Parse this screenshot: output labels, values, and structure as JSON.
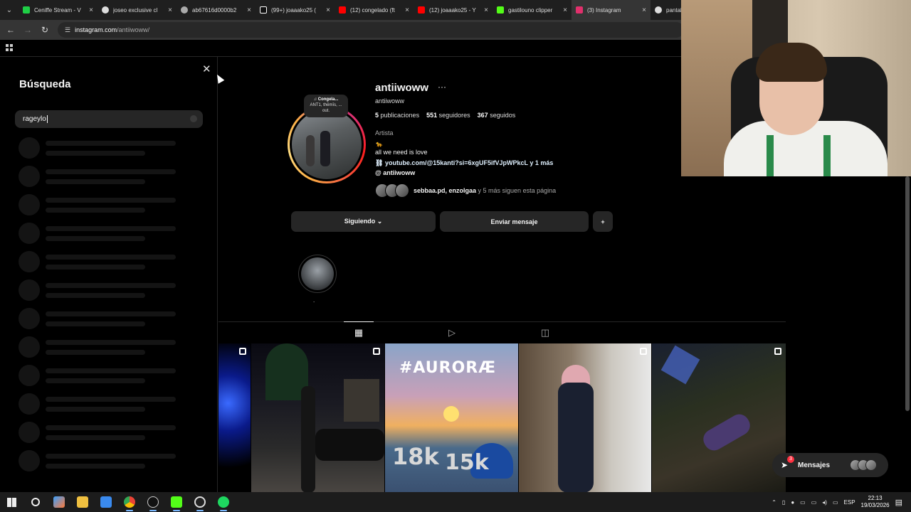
{
  "browser": {
    "tabs": [
      {
        "title": "Ceniffe Stream - V",
        "fav": "#1fcf46"
      },
      {
        "title": "joseo exclusive cl",
        "fav": "#dddddd"
      },
      {
        "title": "ab67616d0000b2",
        "fav": "#aaaaaa"
      },
      {
        "title": "(99+) joaaako25 (",
        "fav": "#111111"
      },
      {
        "title": "(12) congelado (ft",
        "fav": "#ff0000"
      },
      {
        "title": "(12) joaaako25 - Y",
        "fav": "#ff0000"
      },
      {
        "title": "gastilouno clipper",
        "fav": "#53fc18"
      },
      {
        "title": "(3) Instagram",
        "fav": "#e1306c"
      },
      {
        "title": "pantal",
        "fav": "#dddddd"
      }
    ],
    "url_host": "instagram.com",
    "url_path": "/antiiwoww/"
  },
  "search": {
    "title": "Búsqueda",
    "query": "rageylo"
  },
  "profile": {
    "username": "antiiwoww",
    "more": "···",
    "handle": "antiiwoww",
    "posts_count": "5",
    "posts_label": "publicaciones",
    "followers_count": "551",
    "followers_label": "seguidores",
    "following_count": "367",
    "following_label": "seguidos",
    "category": "Artista",
    "emoji": "🐆",
    "bio": "all we need is love",
    "link": "youtube.com/@15kanti?si=6xgUF5ifVJpWPkcL y 1 más",
    "threads": "antiiwoww",
    "followed_by_names": "sebbaa.pd, enzolgaa",
    "followed_by_rest": " y 5 más siguen esta página",
    "note_title": "Congela...",
    "note_line2": "ANT1, thēmīs, ...",
    "note_line3": "out."
  },
  "buttons": {
    "following": "Siguiendo ⌄",
    "message": "Enviar mensaje",
    "add_user": "+"
  },
  "highlight": {
    "label": "."
  },
  "posts": [
    {
      "kind": "abstract"
    },
    {
      "kind": "street"
    },
    {
      "kind": "aurora",
      "text": "#AURORÆ",
      "k1": "18k",
      "k2": "15k"
    },
    {
      "kind": "mirror"
    },
    {
      "kind": "night"
    }
  ],
  "messages": {
    "label": "Mensajes",
    "badge": "3"
  },
  "taskbar": {
    "lang": "ESP",
    "time": "22:13",
    "date": "19/03/2026"
  },
  "colors": {
    "accent": "#0095f6",
    "badge": "#ff3040"
  }
}
